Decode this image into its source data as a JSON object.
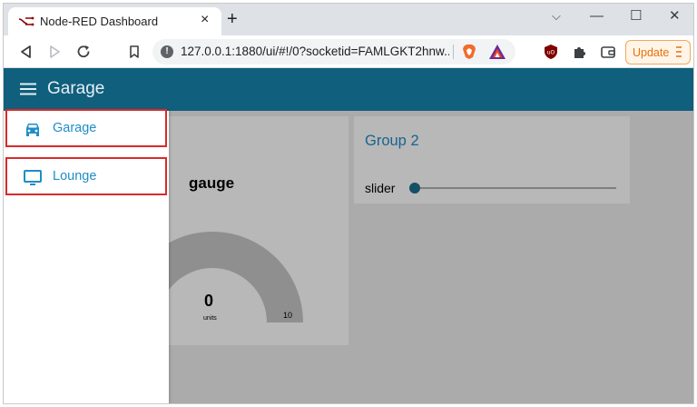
{
  "browser": {
    "tab_title": "Node-RED Dashboard",
    "tab_close": "×",
    "new_tab": "+",
    "url": "127.0.0.1:1880/ui/#!/0?socketid=FAMLGKT2hnw...",
    "update_label": "Update",
    "window_controls": {
      "menu": "⌵",
      "minimize": "—",
      "maximize": "☐",
      "close": "✕"
    },
    "icons": [
      "back-icon",
      "forward-icon",
      "reload-icon",
      "bookmark-icon",
      "info-icon",
      "brave-shields-icon",
      "bat-rewards-icon",
      "ublock-icon",
      "extensions-icon",
      "wallet-icon",
      "menu-icon"
    ]
  },
  "dashboard": {
    "header_title": "Garage",
    "header_color": "#0f5f7d",
    "accent_color": "#1f8dc7",
    "nav": [
      {
        "label": "Garage",
        "icon": "car-icon",
        "selected": true
      },
      {
        "label": "Lounge",
        "icon": "monitor-icon",
        "selected": true
      }
    ],
    "gauge": {
      "title": "gauge",
      "value": "0",
      "units": "units",
      "max": "10",
      "fraction": 0
    },
    "group2": {
      "title": "Group 2",
      "slider_label": "slider",
      "slider_fraction": 0
    }
  }
}
